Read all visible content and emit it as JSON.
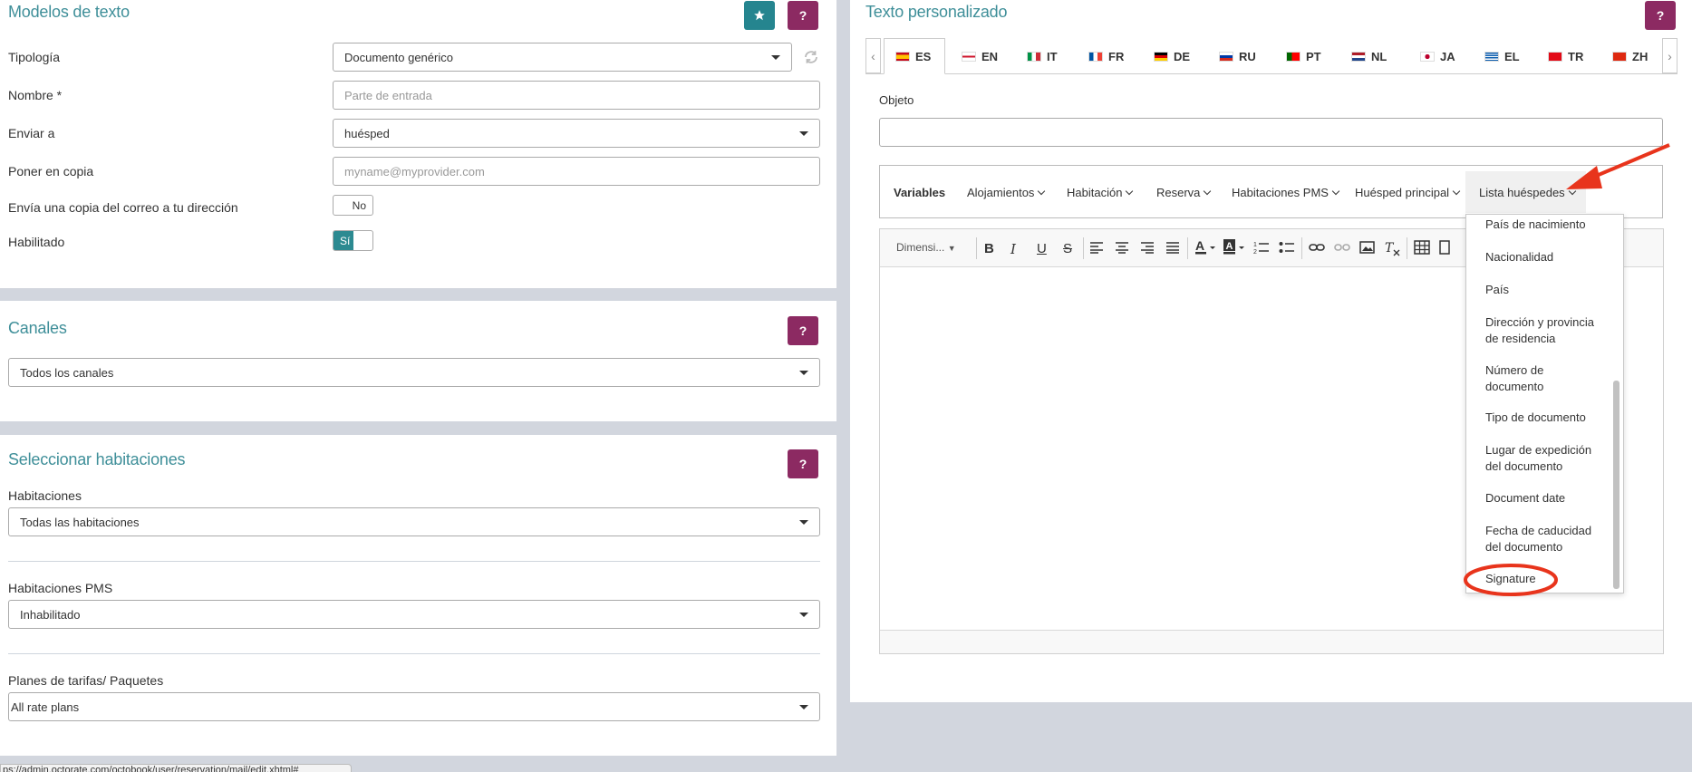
{
  "left_panel": {
    "title": "Modelos de texto",
    "fields": {
      "tipologia_label": "Tipología",
      "tipologia_value": "Documento genérico",
      "nombre_label": "Nombre *",
      "nombre_placeholder": "Parte de entrada",
      "enviar_label": "Enviar a",
      "enviar_value": "huésped",
      "copia_label": "Poner en copia",
      "copia_placeholder": "myname@myprovider.com",
      "envia_label": "Envía una copia del correo a tu dirección",
      "envia_toggle": "No",
      "habilitado_label": "Habilitado",
      "habilitado_toggle": "Sí"
    },
    "help_label": "?"
  },
  "canales_panel": {
    "title": "Canales",
    "select_value": "Todos los canales",
    "help_label": "?"
  },
  "habitaciones_panel": {
    "title": "Seleccionar habitaciones",
    "help_label": "?",
    "habitaciones_label": "Habitaciones",
    "habitaciones_value": "Todas las habitaciones",
    "pms_label": "Habitaciones PMS",
    "pms_value": "Inhabilitado",
    "planes_label": "Planes de tarifas/ Paquetes",
    "planes_value": "All rate plans"
  },
  "right_panel": {
    "title": "Texto personalizado",
    "help_label": "?",
    "prev_arrow": "‹",
    "next_arrow": "›",
    "tabs": [
      {
        "code": "ES"
      },
      {
        "code": "EN"
      },
      {
        "code": "IT"
      },
      {
        "code": "FR"
      },
      {
        "code": "DE"
      },
      {
        "code": "RU"
      },
      {
        "code": "PT"
      },
      {
        "code": "NL"
      },
      {
        "code": "JA"
      },
      {
        "code": "EL"
      },
      {
        "code": "TR"
      },
      {
        "code": "ZH"
      }
    ],
    "objeto_label": "Objeto",
    "variables": {
      "label": "Variables",
      "menus": [
        "Alojamientos",
        "Habitación",
        "Reserva",
        "Habitaciones PMS",
        "Huésped principal",
        "Lista huéspedes"
      ]
    },
    "editor": {
      "font_size_placeholder": "Dimensi...",
      "tools": [
        "B",
        "I",
        "U",
        "S"
      ]
    },
    "dropdown_items": [
      "País de nacimiento",
      "Nacionalidad",
      "País",
      "Dirección y provincia de residencia",
      "Número de documento",
      "Tipo de documento",
      "Lugar de expedición del documento",
      "Document date",
      "Fecha de caducidad del documento",
      "Signature"
    ]
  },
  "status_bar": "ps://admin.octorate.com/octobook/user/reservation/mail/edit.xhtml#",
  "colors": {
    "accent_teal": "#3f8f99",
    "help_purple": "#8c2a62",
    "annotation_red": "#e8341c"
  }
}
